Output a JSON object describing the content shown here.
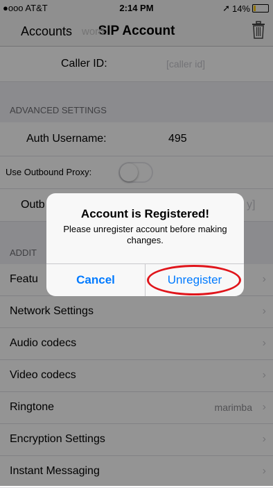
{
  "status_bar": {
    "carrier": "●ooo AT&T",
    "time": "2:14 PM",
    "battery": "14%",
    "battery_level": 0.14
  },
  "nav": {
    "back_label": "Accounts",
    "title": "SIP Account",
    "ghost_text": "word:",
    "trash_icon": "trash-icon"
  },
  "caller_id": {
    "label": "Caller ID:",
    "placeholder": "[caller id]"
  },
  "advanced_header": "ADVANCED SETTINGS",
  "auth_username": {
    "label": "Auth Username:",
    "value": "495"
  },
  "outbound_proxy": {
    "label": "Use Outbound Proxy:",
    "enabled": false
  },
  "outbound_row": {
    "label": "Outb",
    "value_fragment": "y]"
  },
  "additional_header": "ADDIT",
  "menu_items": [
    {
      "label": "Featu",
      "value": ""
    },
    {
      "label": "Network Settings",
      "value": ""
    },
    {
      "label": "Audio codecs",
      "value": ""
    },
    {
      "label": "Video codecs",
      "value": ""
    },
    {
      "label": "Ringtone",
      "value": "marimba"
    },
    {
      "label": "Encryption Settings",
      "value": ""
    },
    {
      "label": "Instant Messaging",
      "value": ""
    }
  ],
  "alert": {
    "title": "Account is Registered!",
    "message": "Please unregister account before making changes.",
    "cancel_label": "Cancel",
    "unregister_label": "Unregister"
  },
  "colors": {
    "accent": "#007aff",
    "highlight": "#e0151b"
  }
}
